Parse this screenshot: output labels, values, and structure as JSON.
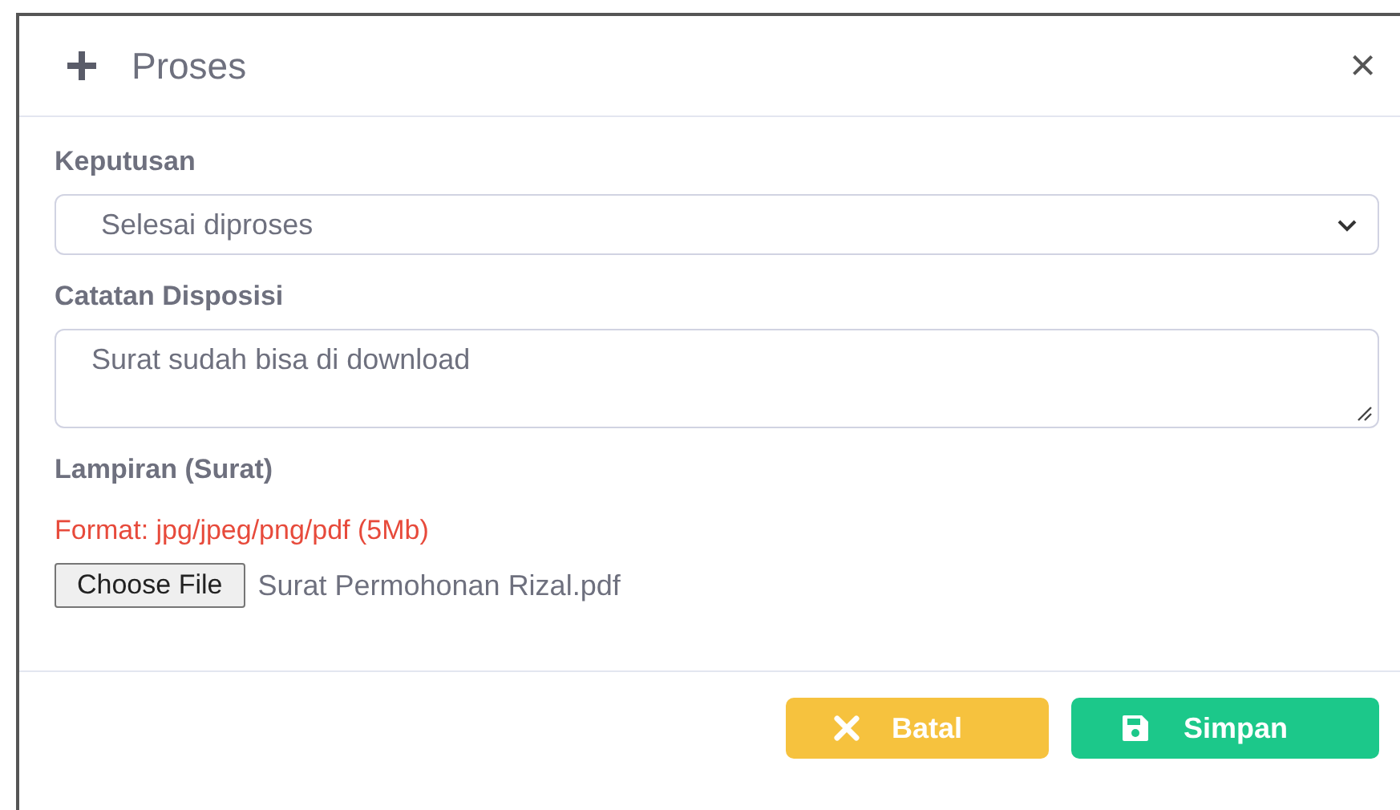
{
  "dialog": {
    "title": "Proses",
    "close": "×"
  },
  "fields": [
    {
      "kind": "select",
      "label": "Keputusan",
      "value": "Selesai diproses"
    },
    {
      "kind": "textarea",
      "label": "Catatan Disposisi",
      "value": "Surat sudah bisa di download"
    },
    {
      "kind": "file",
      "label": "Lampiran (Surat)",
      "hint": "Format: jpg/jpeg/png/pdf (5Mb)",
      "button": "Choose File",
      "file_name": "Surat Permohonan Rizal.pdf"
    }
  ],
  "buttons": [
    {
      "kind": "cancel",
      "label": "Batal"
    },
    {
      "kind": "save",
      "label": "Simpan"
    }
  ]
}
